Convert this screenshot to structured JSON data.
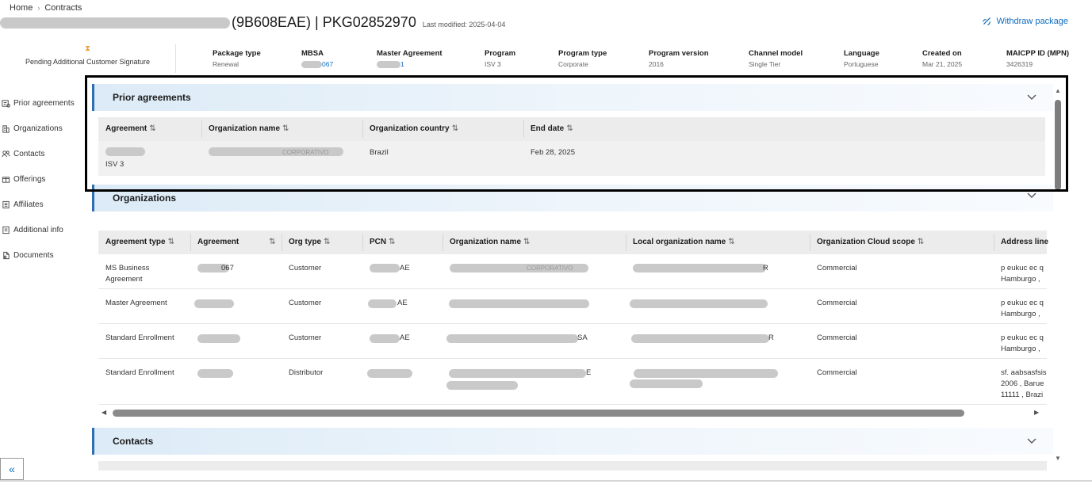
{
  "breadcrumb": {
    "home": "Home",
    "separator": "›",
    "current": "Contracts"
  },
  "header": {
    "title": "(9B608EAE) | PKG02852970",
    "last_modified": "Last modified: 2025-04-04",
    "withdraw_label": "Withdraw package"
  },
  "summary": {
    "status": "Pending Additional Customer Signature",
    "fields": [
      {
        "label": "Package type",
        "value": "Renewal"
      },
      {
        "label": "MBSA",
        "value": "067"
      },
      {
        "label": "Master Agreement",
        "value": "1"
      },
      {
        "label": "Program",
        "value": "ISV 3"
      },
      {
        "label": "Program type",
        "value": "Corporate"
      },
      {
        "label": "Program version",
        "value": "2016"
      },
      {
        "label": "Channel model",
        "value": "Single Tier"
      },
      {
        "label": "Language",
        "value": "Portuguese"
      },
      {
        "label": "Created on",
        "value": "Mar 21, 2025"
      },
      {
        "label": "MAICPP ID (MPN)",
        "value": "3426319"
      }
    ]
  },
  "nav": {
    "items": [
      {
        "label": "Prior agreements",
        "icon": "history-icon"
      },
      {
        "label": "Organizations",
        "icon": "building-icon"
      },
      {
        "label": "Contacts",
        "icon": "people-icon"
      },
      {
        "label": "Offerings",
        "icon": "offering-icon"
      },
      {
        "label": "Affiliates",
        "icon": "affiliate-icon"
      },
      {
        "label": "Additional info",
        "icon": "info-document-icon"
      },
      {
        "label": "Documents",
        "icon": "documents-icon"
      }
    ],
    "collapse_label": "«"
  },
  "prior_agreements": {
    "title": "Prior agreements",
    "columns": [
      "Agreement",
      "Organization name",
      "Organization country",
      "End date"
    ],
    "rows": [
      {
        "agreement": "ISV 3",
        "org_name": "CORPORATIVO",
        "country": "Brazil",
        "end_date": "Feb 28, 2025"
      }
    ]
  },
  "organizations": {
    "title": "Organizations",
    "columns": [
      "Agreement type",
      "Agreement",
      "Org type",
      "PCN",
      "Organization name",
      "Local organization name",
      "Organization Cloud scope",
      "Address line"
    ],
    "rows": [
      {
        "agreement_type": "MS Business Agreement",
        "agreement": "067",
        "org_type": "Customer",
        "pcn": "AE",
        "org_name": "CORPORATIVO",
        "local_name": "R",
        "scope": "Commercial",
        "address": "p eukuc ec q Hamburgo ,"
      },
      {
        "agreement_type": "Master Agreement",
        "agreement": "",
        "org_type": "Customer",
        "pcn": "AE",
        "org_name": "",
        "local_name": "",
        "scope": "Commercial",
        "address": "p eukuc ec q Hamburgo ,"
      },
      {
        "agreement_type": "Standard Enrollment",
        "agreement": "",
        "org_type": "Customer",
        "pcn": "AE",
        "org_name": "SA",
        "local_name": "R",
        "scope": "Commercial",
        "address": "p eukuc ec q Hamburgo ,"
      },
      {
        "agreement_type": "Standard Enrollment",
        "agreement": "",
        "org_type": "Distributor",
        "pcn": "",
        "org_name": "E",
        "local_name": "",
        "scope": "Commercial",
        "address": "sf. aabsasfsis 2006 , Barue 11111 , Brazi"
      }
    ]
  },
  "contacts": {
    "title": "Contacts"
  },
  "colors": {
    "accent": "#0f6cbd",
    "section_border": "#2f6fb0",
    "status_icon": "#e8a33c"
  }
}
